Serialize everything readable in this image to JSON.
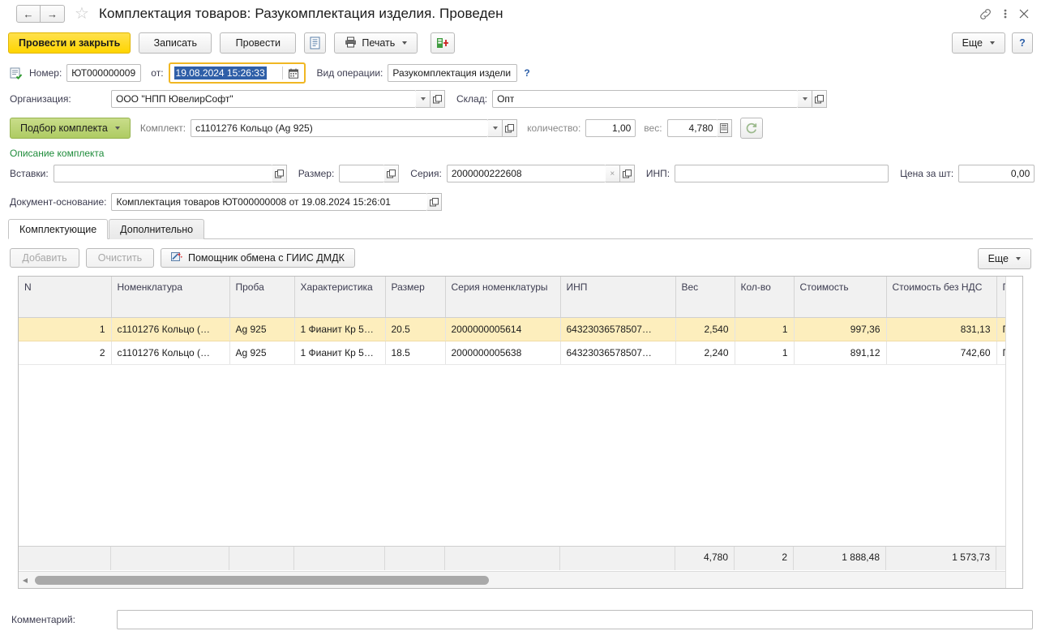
{
  "window": {
    "title": "Комплектация товаров: Разукомплектация изделия. Проведен",
    "back_icon": "arrow-left-icon",
    "forward_icon": "arrow-right-icon",
    "favorite_icon": "star-icon",
    "link_icon": "link-icon",
    "menu_icon": "kebab-menu-icon",
    "close_icon": "close-icon"
  },
  "commandbar": {
    "post_and_close": "Провести и закрыть",
    "write": "Записать",
    "post": "Провести",
    "register_icon": "document-register-icon",
    "print": "Печать",
    "print_icon": "printer-icon",
    "exchange_icon": "gii s-exchange-icon",
    "more": "Еще",
    "help": "?"
  },
  "header_form": {
    "status_icon": "posted-document-icon",
    "number_label": "Номер:",
    "number_value": "ЮТ000000009",
    "date_label": "от:",
    "date_value": "19.08.2024 15:26:33",
    "calendar_icon": "calendar-icon",
    "operation_label": "Вид операции:",
    "operation_value": "Разукомплектация издели",
    "operation_help": "?",
    "org_label": "Организация:",
    "org_value": "ООО \"НПП ЮвелирСофт\"",
    "warehouse_label": "Склад:",
    "warehouse_value": "Опт",
    "open_icon": "open-link-icon",
    "dropdown_icon": "chevron-down-icon"
  },
  "kit_row": {
    "select_kit_button": "Подбор комплекта",
    "kit_label": "Комплект:",
    "kit_value": "c1101276 Кольцо (Ag 925)",
    "qty_label": "количество:",
    "qty_value": "1,00",
    "weight_label": "вес:",
    "weight_value": "4,780",
    "calc_icon": "calculator-icon",
    "refresh_icon": "refresh-icon",
    "description_link": "Описание комплекта"
  },
  "attrs_row": {
    "inserts_label": "Вставки:",
    "inserts_value": "",
    "size_label": "Размер:",
    "size_value": "",
    "series_label": "Серия:",
    "series_value": "2000000222608",
    "clear_icon": "clear-x-icon",
    "inp_label": "ИНП:",
    "inp_value": "",
    "price_label": "Цена за шт:",
    "price_value": "0,00",
    "refresh_icon": "refresh-icon"
  },
  "basis_row": {
    "label": "Документ-основание:",
    "value": "Комплектация товаров ЮТ000000008 от 19.08.2024 15:26:01",
    "open_icon": "open-link-icon"
  },
  "tabs": [
    {
      "label": "Комплектующие",
      "active": true
    },
    {
      "label": "Дополнительно",
      "active": false
    }
  ],
  "table_toolbar": {
    "add": "Добавить",
    "clear": "Очистить",
    "assistant": "Помощник обмена с ГИИС ДМДК",
    "assistant_icon": "wizard-wand-icon",
    "more": "Еще"
  },
  "table": {
    "columns": [
      {
        "label": "N",
        "align": "right",
        "width": 114
      },
      {
        "label": "Номенклатура",
        "align": "left",
        "width": 146
      },
      {
        "label": "Проба",
        "align": "left",
        "width": 80
      },
      {
        "label": "Характеристика",
        "align": "left",
        "width": 112
      },
      {
        "label": "Размер",
        "align": "left",
        "width": 74
      },
      {
        "label": "Серия номенклатуры",
        "align": "left",
        "width": 142
      },
      {
        "label": "ИНП",
        "align": "left",
        "width": 142
      },
      {
        "label": "Вес",
        "align": "right",
        "width": 73
      },
      {
        "label": "Кол-во",
        "align": "right",
        "width": 73
      },
      {
        "label": "Стоимость",
        "align": "right",
        "width": 114
      },
      {
        "label": "Стоимость без НДС",
        "align": "right",
        "width": 136
      },
      {
        "label": "Партия",
        "align": "left",
        "width": 62
      }
    ],
    "rows": [
      {
        "selected": true,
        "cells": [
          "1",
          "c1101276 Кольцо (…",
          "Ag 925",
          "1 Фианит Кр 5…",
          "20.5",
          "2000000005614",
          "64323036578507…",
          "2,540",
          "1",
          "997,36",
          "831,13",
          "Поступ"
        ]
      },
      {
        "selected": false,
        "cells": [
          "2",
          "c1101276 Кольцо (…",
          "Ag 925",
          "1 Фианит Кр 5…",
          "18.5",
          "2000000005638",
          "64323036578507…",
          "2,240",
          "1",
          "891,12",
          "742,60",
          "Поступ"
        ]
      }
    ],
    "totals": [
      "",
      "",
      "",
      "",
      "",
      "",
      "",
      "4,780",
      "2",
      "1 888,48",
      "1 573,73",
      ""
    ]
  },
  "comment": {
    "label": "Комментарий:",
    "value": "",
    "placeholder": ""
  },
  "colors": {
    "primary_button": "#ffd500",
    "kit_button": "#b8d06a",
    "selected_row": "#fdeebd",
    "link_green": "#1f8c3b",
    "focus_border": "#f0b723",
    "selection_blue": "#2f5fa8"
  }
}
